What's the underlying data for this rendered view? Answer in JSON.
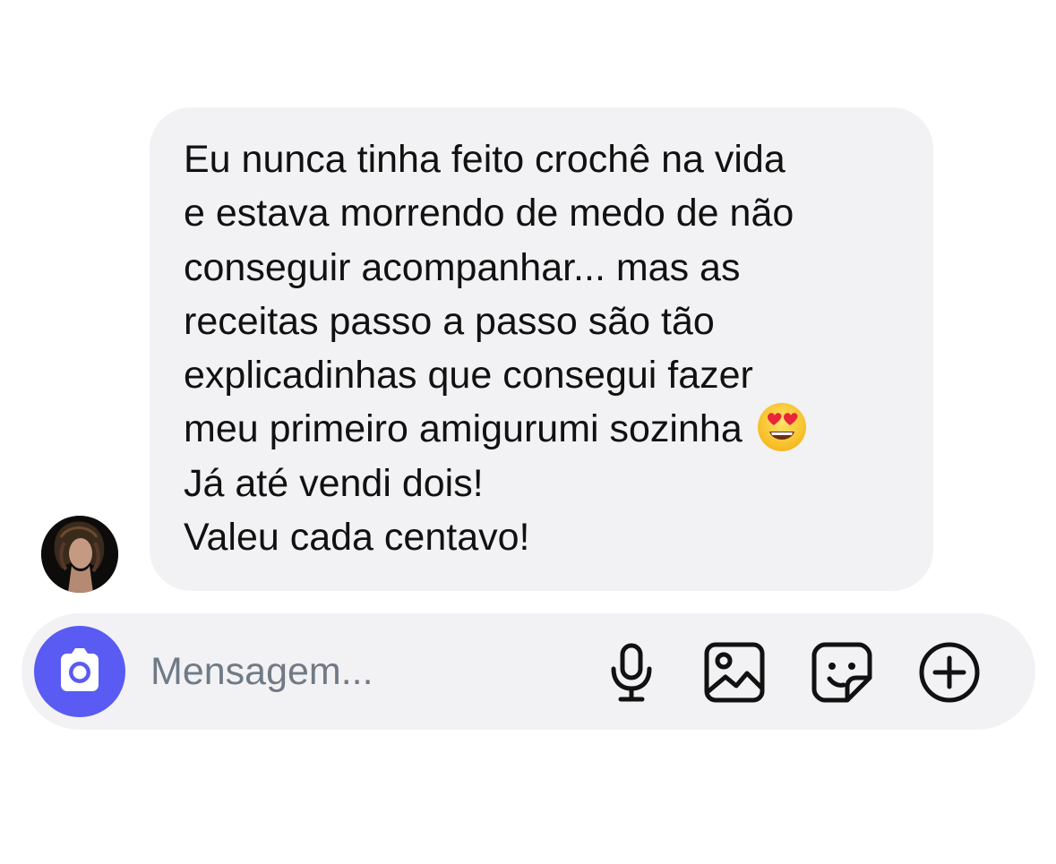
{
  "message": {
    "lines": [
      "Eu nunca tinha feito crochê na vida",
      "e estava morrendo de medo de não",
      "conseguir acompanhar... mas as",
      "receitas passo a passo são tão",
      "explicadinhas que consegui fazer",
      "meu primeiro amigurumi sozinha",
      "Já até vendi dois!",
      "Valeu cada centavo!"
    ],
    "emoji": "smiling-face-with-heart-eyes",
    "sender_avatar": "avatar"
  },
  "composer": {
    "placeholder": "Mensagem...",
    "value": "",
    "camera_icon": "camera-icon",
    "mic_icon": "microphone-icon",
    "gallery_icon": "image-gallery-icon",
    "sticker_icon": "sticker-icon",
    "plus_icon": "plus-circle-icon"
  },
  "colors": {
    "bubble_bg": "#f2f2f4",
    "composer_bg": "#f2f2f4",
    "camera_button": "#5a5bf2",
    "placeholder": "#707a86",
    "text": "#111111"
  }
}
